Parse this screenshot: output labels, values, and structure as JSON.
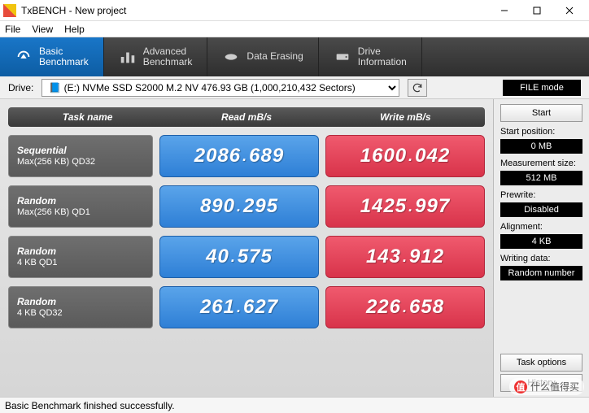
{
  "window": {
    "title": "TxBENCH - New project"
  },
  "menu": {
    "file": "File",
    "view": "View",
    "help": "Help"
  },
  "tabs": {
    "basic": "Basic\nBenchmark",
    "advanced": "Advanced\nBenchmark",
    "erasing": "Data Erasing",
    "drive": "Drive\nInformation"
  },
  "drive": {
    "label": "Drive:",
    "selected": "📘 (E:) NVMe SSD S2000 M.2 NV   476.93 GB (1,000,210,432 Sectors)",
    "filemode_btn": "FILE mode"
  },
  "headers": {
    "task": "Task name",
    "read": "Read mB/s",
    "write": "Write mB/s"
  },
  "rows": [
    {
      "name1": "Sequential",
      "name2": "Max(256 KB) QD32",
      "read": "2086.689",
      "write": "1600.042"
    },
    {
      "name1": "Random",
      "name2": "Max(256 KB) QD1",
      "read": "890.295",
      "write": "1425.997"
    },
    {
      "name1": "Random",
      "name2": "4 KB QD1",
      "read": "40.575",
      "write": "143.912"
    },
    {
      "name1": "Random",
      "name2": "4 KB QD32",
      "read": "261.627",
      "write": "226.658"
    }
  ],
  "side": {
    "start": "Start",
    "start_pos_label": "Start position:",
    "start_pos": "0 MB",
    "meas_label": "Measurement size:",
    "meas": "512 MB",
    "prewrite_label": "Prewrite:",
    "prewrite": "Disabled",
    "align_label": "Alignment:",
    "align": "4 KB",
    "writing_label": "Writing data:",
    "writing": "Random number",
    "task_options": "Task options",
    "history": "History"
  },
  "status": "Basic Benchmark finished successfully.",
  "watermark": "什么值得买"
}
